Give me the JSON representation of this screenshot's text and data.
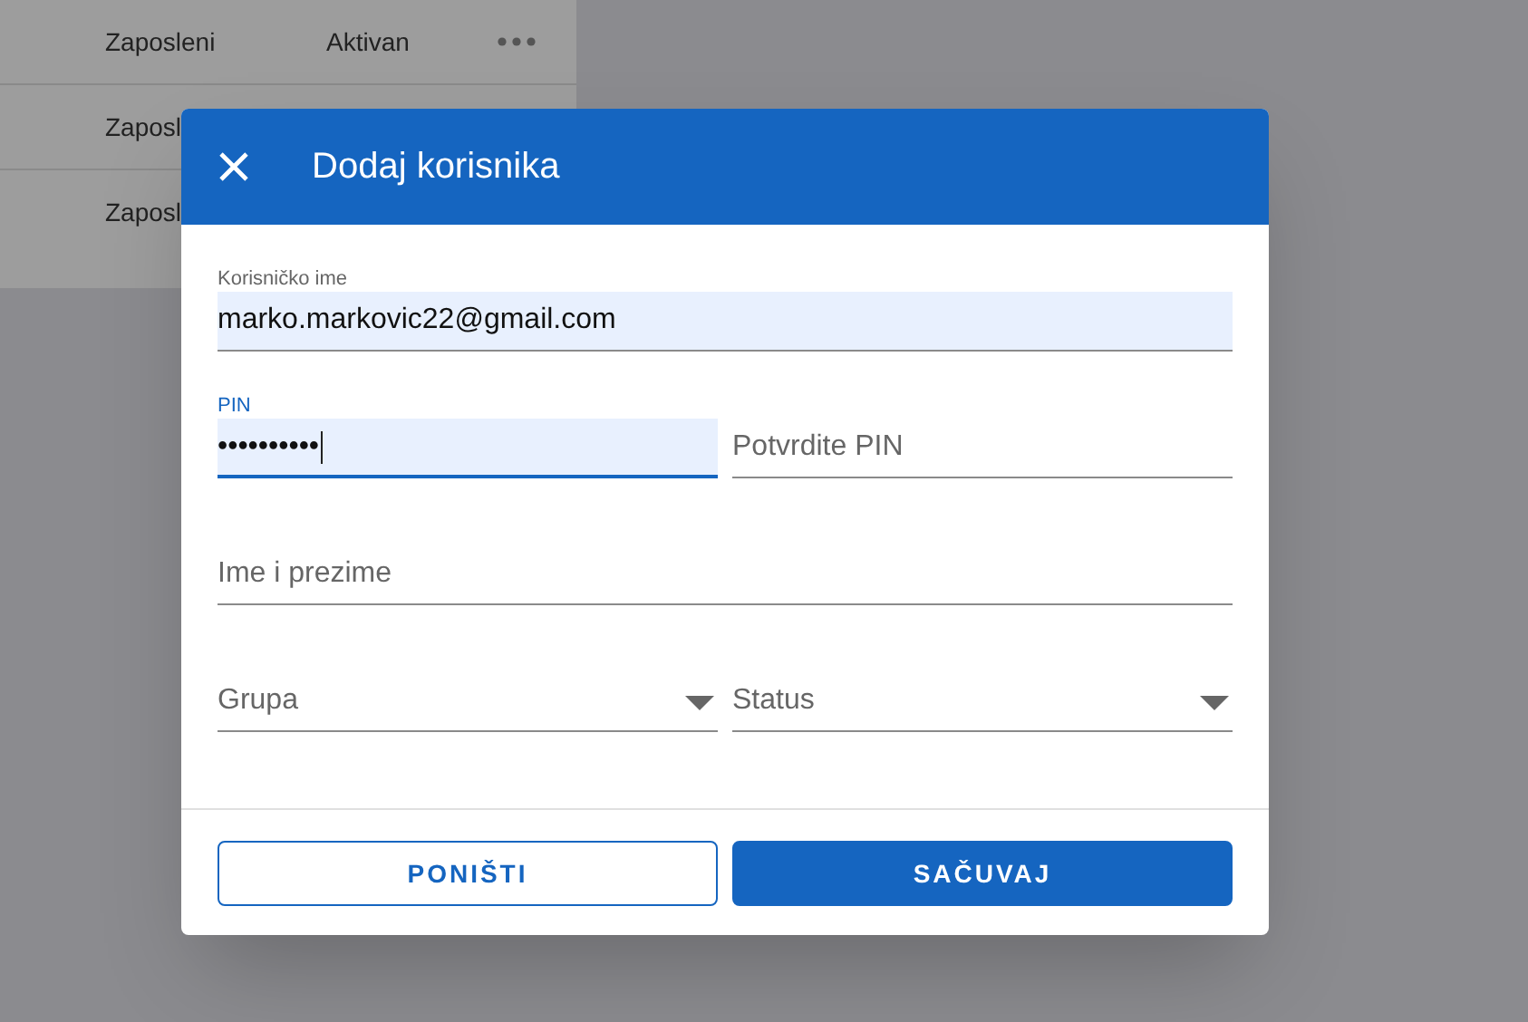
{
  "background_table": {
    "rows": [
      {
        "column_1": "Zaposleni",
        "column_2": "Aktivan"
      },
      {
        "column_1": "Zaposl"
      },
      {
        "column_1": "Zaposl"
      }
    ]
  },
  "dialog": {
    "title": "Dodaj korisnika",
    "field_rows": [
      [
        {
          "kind": "text",
          "label": "Korisničko ime",
          "value": "marko.markovic22@gmail.com",
          "focused": false
        }
      ],
      [
        {
          "kind": "text",
          "label": "PIN",
          "value": "••••••••••",
          "focused": true
        },
        {
          "kind": "text",
          "placeholder": "Potvrdite PIN",
          "focused": false
        }
      ],
      [
        {
          "kind": "text",
          "placeholder": "Ime i prezime",
          "focused": false
        }
      ],
      [
        {
          "kind": "select",
          "placeholder": "Grupa",
          "focused": false
        },
        {
          "kind": "select",
          "placeholder": "Status",
          "focused": false
        }
      ]
    ],
    "buttons": [
      {
        "label": "PONIŠTI",
        "kind": "outlined"
      },
      {
        "label": "SAČUVAJ",
        "kind": "primary"
      }
    ]
  }
}
